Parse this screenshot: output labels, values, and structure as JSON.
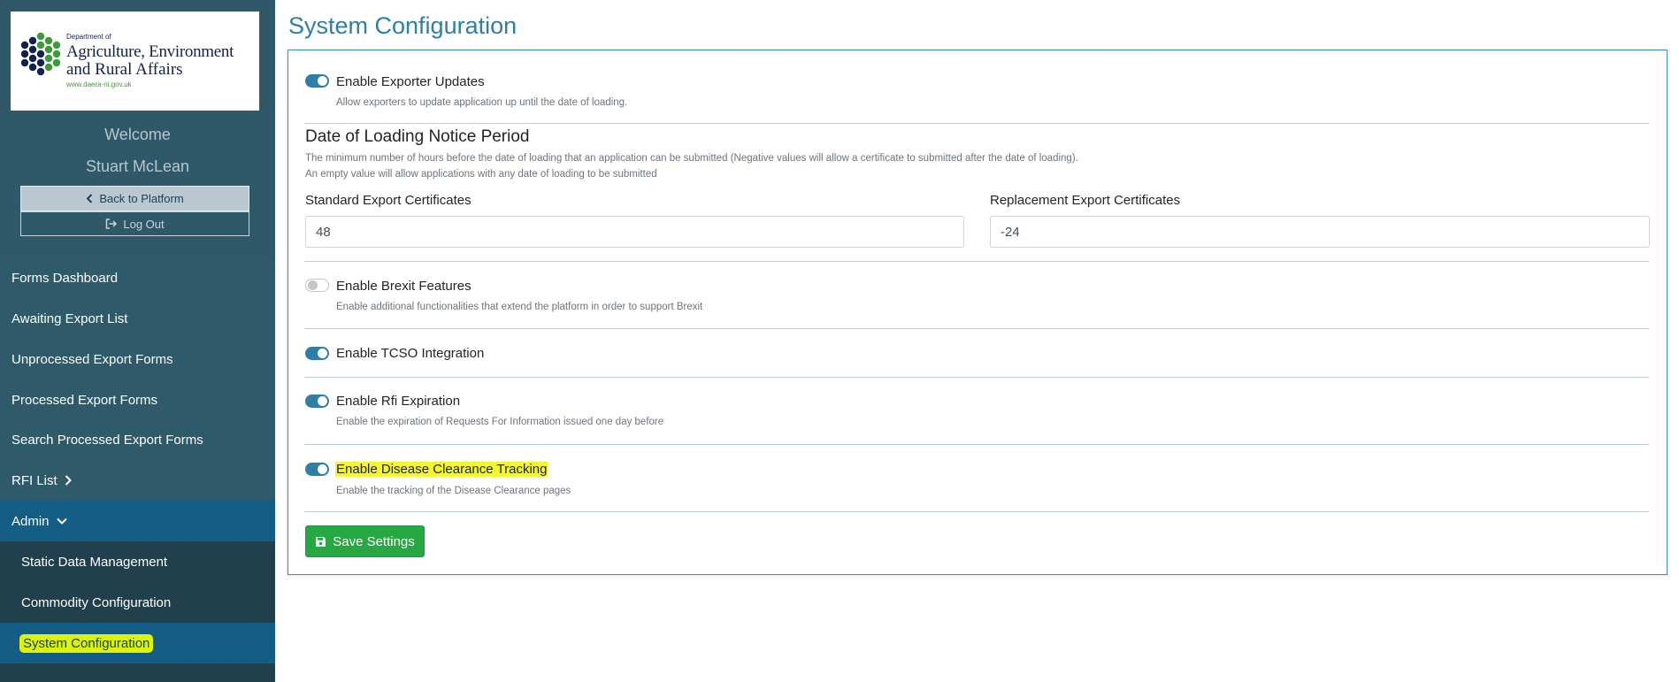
{
  "sidebar": {
    "logo": {
      "small": "Department of",
      "line1": "Agriculture, Environment",
      "line2": "and Rural Affairs",
      "url": "www.daera-ni.gov.uk"
    },
    "welcome": "Welcome",
    "user_name": "Stuart McLean",
    "back_label": "Back to Platform",
    "logout_label": "Log Out",
    "nav": [
      {
        "label": "Forms Dashboard"
      },
      {
        "label": "Awaiting Export List"
      },
      {
        "label": "Unprocessed Export Forms"
      },
      {
        "label": "Processed Export Forms"
      },
      {
        "label": "Search Processed Export Forms"
      },
      {
        "label": "RFI List"
      },
      {
        "label": "Admin"
      },
      {
        "label": "Static Data Management"
      },
      {
        "label": "Commodity Configuration"
      },
      {
        "label": "System Configuration"
      }
    ]
  },
  "main": {
    "title": "System Configuration",
    "options": {
      "exporter_updates": {
        "title": "Enable Exporter Updates",
        "desc": "Allow exporters to update application up until the date of loading.",
        "enabled": true
      },
      "brexit": {
        "title": "Enable Brexit Features",
        "desc": "Enable additional functionalities that extend the platform in order to support Brexit",
        "enabled": false
      },
      "tcso": {
        "title": "Enable TCSO Integration",
        "enabled": true
      },
      "rfi_expiration": {
        "title": "Enable Rfi Expiration",
        "desc": "Enable the expiration of Requests For Information issued one day before",
        "enabled": true
      },
      "disease_clearance": {
        "title": "Enable Disease Clearance Tracking",
        "desc": "Enable the tracking of the Disease Clearance pages",
        "enabled": true
      }
    },
    "notice_period": {
      "title": "Date of Loading Notice Period",
      "desc1": "The minimum number of hours before the date of loading that an application can be submitted (Negative values will allow a certificate to submitted after the date of loading).",
      "desc2": "An empty value will allow applications with any date of loading to be submitted",
      "standard_label": "Standard Export Certificates",
      "standard_value": "48",
      "replacement_label": "Replacement Export Certificates",
      "replacement_value": "-24"
    },
    "save_label": "Save Settings"
  },
  "colors": {
    "sidebar": "#2e5a6a",
    "accent": "#2f7fa5",
    "nav_active": "#145e85",
    "save": "#28a745",
    "highlight": "#f4f72b"
  }
}
